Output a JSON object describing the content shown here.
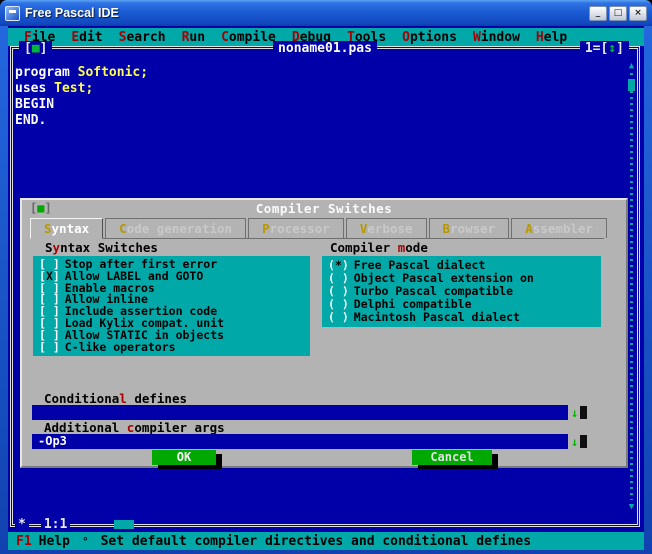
{
  "colors": {
    "dos_blue": "#0000A8",
    "dos_cyan": "#00A8A8",
    "dialog_gray": "#B3B3B3",
    "button_green": "#00A800",
    "ident_yellow": "#FCFC54",
    "hotkey_red": "#A80000",
    "titlebar_blue": "#1C5CD4"
  },
  "window": {
    "title": "Free Pascal IDE",
    "controls": {
      "minimize": "_",
      "maximize": "□",
      "close": "×"
    }
  },
  "menu": {
    "items": [
      {
        "hot": "F",
        "post": "ile"
      },
      {
        "hot": "E",
        "post": "dit"
      },
      {
        "hot": "S",
        "post": "earch"
      },
      {
        "hot": "R",
        "post": "un"
      },
      {
        "hot": "C",
        "post": "ompile"
      },
      {
        "hot": "D",
        "post": "ebug"
      },
      {
        "hot": "T",
        "post": "ools"
      },
      {
        "hot": "O",
        "post": "ptions"
      },
      {
        "hot": "W",
        "post": "indow"
      },
      {
        "hot": "H",
        "post": "elp"
      }
    ]
  },
  "editor": {
    "title": "noname01.pas",
    "close_box": {
      "prefix": "[",
      "glyph": "■",
      "suffix": "]"
    },
    "zoom_box": {
      "prefix": "1=[",
      "glyph": "↕",
      "suffix": "]"
    },
    "lines": [
      {
        "keyword": "program ",
        "ident": "Softonic;"
      },
      {
        "keyword": "uses ",
        "ident": "Test;"
      },
      {
        "keyword": "BEGIN",
        "ident": ""
      },
      {
        "keyword": "END.",
        "ident": ""
      }
    ],
    "scrollbar": {
      "up": "▲",
      "down": "▼"
    },
    "status": {
      "modified": "*",
      "position": "1:1"
    }
  },
  "dialog": {
    "title": "Compiler Switches",
    "close_box": {
      "prefix": "[",
      "glyph": "■",
      "suffix": "]"
    },
    "tabs": [
      {
        "hot": "S",
        "post": "yntax"
      },
      {
        "hot": "C",
        "post": "ode generation"
      },
      {
        "hot": "P",
        "post": "rocessor"
      },
      {
        "hot": "V",
        "post": "erbose"
      },
      {
        "hot": "B",
        "post": "rowser"
      },
      {
        "hot": "A",
        "post": "ssembler"
      }
    ],
    "glyphs": {
      "cb_open": "[",
      "cb_close": "]",
      "rb_open": "(",
      "rb_close": ")",
      "history": "↓"
    },
    "syntax_group": {
      "label": {
        "pre": "S",
        "hot": "y",
        "post": "ntax Switches"
      },
      "items": [
        {
          "mark": " ",
          "label": "Stop after first error"
        },
        {
          "mark": "X",
          "label": "Allow LABEL and GOTO"
        },
        {
          "mark": " ",
          "label": "Enable macros"
        },
        {
          "mark": " ",
          "label": "Allow inline"
        },
        {
          "mark": " ",
          "label": "Include assertion code"
        },
        {
          "mark": " ",
          "label": "Load Kylix compat. unit"
        },
        {
          "mark": " ",
          "label": "Allow STATIC in objects"
        },
        {
          "mark": " ",
          "label": "C-like operators"
        }
      ]
    },
    "mode_group": {
      "label": {
        "pre": "Compiler ",
        "hot": "m",
        "post": "ode"
      },
      "items": [
        {
          "mark": "*",
          "label": "Free Pascal dialect"
        },
        {
          "mark": " ",
          "label": "Object Pascal extension on"
        },
        {
          "mark": " ",
          "label": "Turbo Pascal compatible"
        },
        {
          "mark": " ",
          "label": "Delphi compatible"
        },
        {
          "mark": " ",
          "label": "Macintosh Pascal dialect"
        }
      ]
    },
    "conditional_defines": {
      "label": {
        "pre": "Conditiona",
        "hot": "l",
        "post": " defines"
      },
      "value": ""
    },
    "compiler_args": {
      "label": {
        "pre": "Additional ",
        "hot": "c",
        "post": "ompiler args"
      },
      "value": "-Op3"
    },
    "buttons": {
      "ok": "OK",
      "cancel": "Cancel"
    }
  },
  "statusbar": {
    "key": "F1",
    "key_label": "Help",
    "separator": "°",
    "message": "Set default compiler directives and conditional defines"
  }
}
